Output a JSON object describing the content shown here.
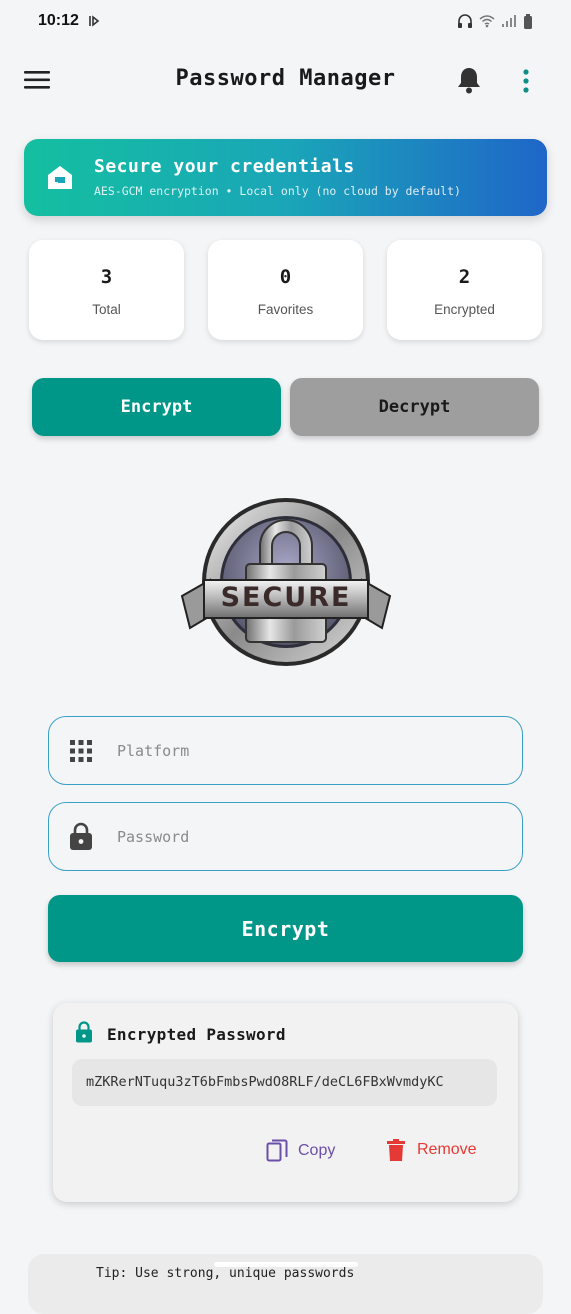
{
  "status_bar": {
    "time": "10:12"
  },
  "app_bar": {
    "title": "Password Manager"
  },
  "banner": {
    "title": "Secure your credentials",
    "subtitle": "AES-GCM encryption • Local only (no cloud by default)"
  },
  "stats": [
    {
      "value": "3",
      "label": "Total"
    },
    {
      "value": "0",
      "label": "Favorites"
    },
    {
      "value": "2",
      "label": "Encrypted"
    }
  ],
  "tabs": {
    "encrypt": "Encrypt",
    "decrypt": "Decrypt",
    "active": "encrypt"
  },
  "emblem": {
    "text": "SECURE"
  },
  "form": {
    "platform_placeholder": "Platform",
    "password_placeholder": "Password",
    "submit_label": "Encrypt"
  },
  "result": {
    "title": "Encrypted Password",
    "value": "mZKRerNTuqu3zT6bFmbsPwdO8RLF/deCL6FBxWvmdyKC",
    "copy_label": "Copy",
    "remove_label": "Remove"
  },
  "peek_card": {
    "text": "Tip: Use strong, unique passwords"
  },
  "colors": {
    "primary": "#009688",
    "inactive_tab": "#9e9e9e",
    "accent_purple": "#6b4fa8",
    "danger": "#e53935",
    "border_blue": "#3aa0c8"
  },
  "icons": [
    "menu-icon",
    "bell-icon",
    "more-vert-icon",
    "home-icon",
    "apps-grid-icon",
    "lock-icon",
    "copy-icon",
    "trash-icon"
  ]
}
